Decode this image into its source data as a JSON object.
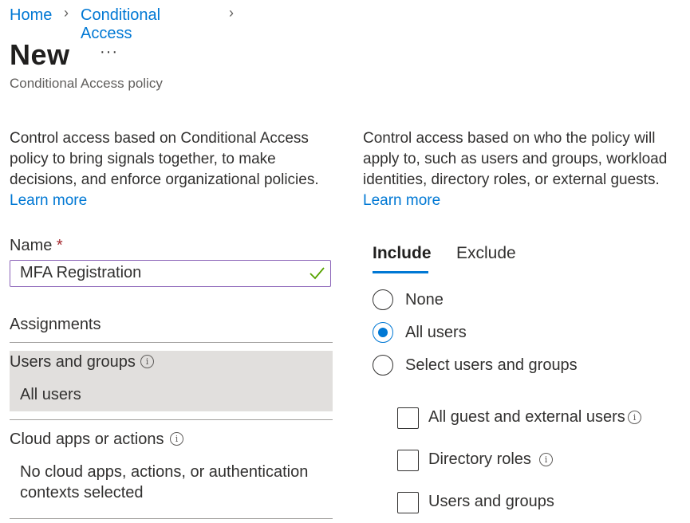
{
  "breadcrumb": {
    "items": [
      "Home",
      "Conditional Access"
    ]
  },
  "header": {
    "title": "New",
    "more": "···",
    "subtitle": "Conditional Access policy"
  },
  "left": {
    "description": "Control access based on Conditional Access policy to bring signals together, to make decisions, and enforce organizational policies.",
    "learn_more": "Learn more",
    "name_label": "Name",
    "required_mark": "*",
    "name_value": "MFA Registration",
    "assignments_heading": "Assignments",
    "users_groups": {
      "label": "Users and groups",
      "value": "All users"
    },
    "cloud_apps": {
      "label": "Cloud apps or actions",
      "value": "No cloud apps, actions, or authentication contexts selected"
    }
  },
  "right": {
    "description": "Control access based on who the policy will apply to, such as users and groups, workload identities, directory roles, or external guests.",
    "learn_more": "Learn more",
    "tabs": [
      "Include",
      "Exclude"
    ],
    "radio_options": [
      "None",
      "All users",
      "Select users and groups"
    ],
    "selected_radio": "All users",
    "checkboxes": [
      "All guest and external users",
      "Directory roles",
      "Users and groups"
    ]
  },
  "colors": {
    "accent": "#0078d4",
    "selected_row_bg": "#e1dfdd",
    "valid_check": "#57a300",
    "required": "#a4262c"
  }
}
